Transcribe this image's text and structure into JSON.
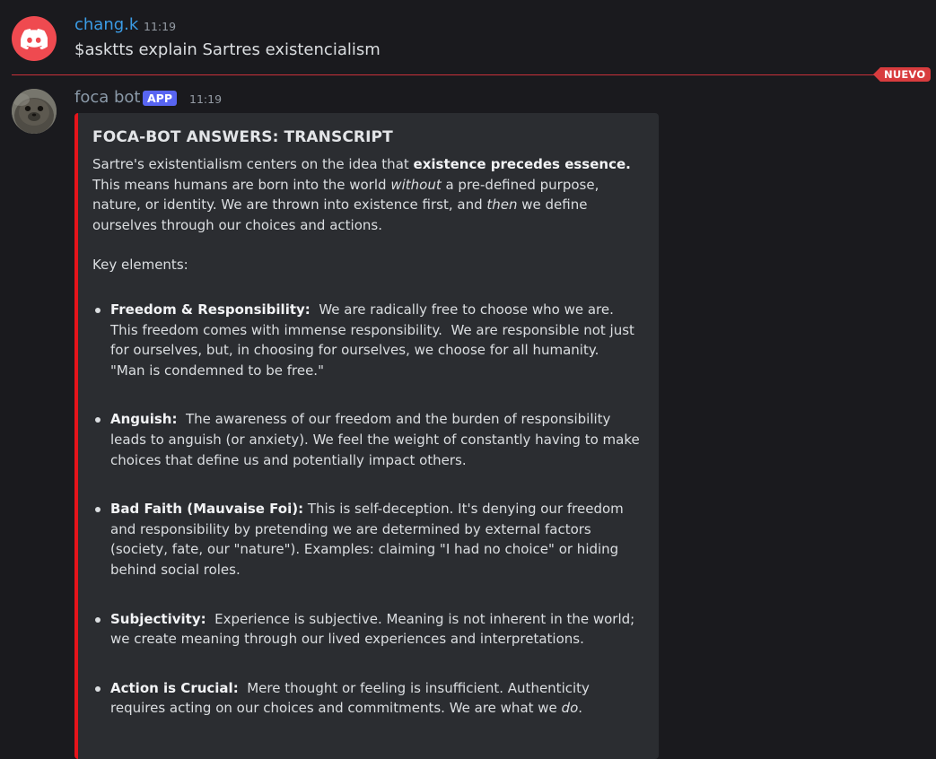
{
  "message1": {
    "username": "chang.k",
    "timestamp": "11:19",
    "content": "$asktts explain Sartres existencialism"
  },
  "divider": {
    "label": "NUEVO"
  },
  "message2": {
    "username": "foca bot",
    "badge": "APP",
    "timestamp": "11:19",
    "embed": {
      "accent_color": "#e5141b",
      "title": "FOCA-BOT ANSWERS: TRANSCRIPT",
      "intro": {
        "t1": "Sartre's existentialism centers on the idea that ",
        "b1": "existence precedes essence.",
        "t2": " This means humans are born into the world ",
        "i1": "without",
        "t3": " a pre-defined purpose, nature, or identity. We are thrown into existence first, and ",
        "i2": "then",
        "t4": " we define ourselves through our choices and actions."
      },
      "key_label": "Key elements:",
      "bullets": [
        {
          "term": "Freedom & Responsibility:",
          "text": "  We are radically free to choose who we are. This freedom comes with immense responsibility.  We are responsible not just for ourselves, but, in choosing for ourselves, we choose for all humanity.  \"Man is condemned to be free.\""
        },
        {
          "term": "Anguish:",
          "text": "  The awareness of our freedom and the burden of responsibility leads to anguish (or anxiety). We feel the weight of constantly having to make choices that define us and potentially impact others."
        },
        {
          "term": "Bad Faith (Mauvaise Foi):",
          "text": " This is self-deception. It's denying our freedom and responsibility by pretending we are determined by external factors (society, fate, our \"nature\"). Examples: claiming \"I had no choice\" or hiding behind social roles."
        },
        {
          "term": "Subjectivity:",
          "text": "  Experience is subjective. Meaning is not inherent in the world; we create meaning through our lived experiences and interpretations."
        },
        {
          "term": "Action is Crucial:",
          "text": "  Mere thought or feeling is insufficient. Authenticity requires acting on our choices and commitments. We are what we ",
          "italic_tail": "do",
          "tail": "."
        }
      ]
    }
  },
  "icons": {
    "avatar1": "discord-logo-icon",
    "avatar2": "seal-avatar"
  }
}
